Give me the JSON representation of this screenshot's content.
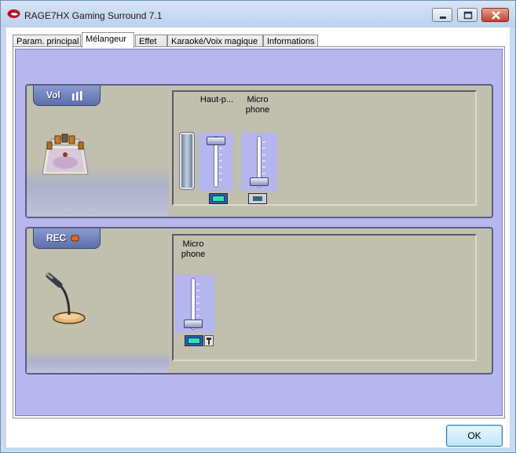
{
  "window": {
    "title": "RAGE7HX Gaming Surround 7.1",
    "app_icon": "red-lips-icon",
    "controls": [
      "minimize",
      "maximize",
      "close"
    ]
  },
  "tabs": [
    {
      "label": "Param. principal",
      "active": false
    },
    {
      "label": "Mélangeur",
      "active": true
    },
    {
      "label": "Effet",
      "active": false
    },
    {
      "label": "Karaoké/Voix magique",
      "active": false
    },
    {
      "label": "Informations",
      "active": false
    }
  ],
  "playback": {
    "header_label": "Vol",
    "header_icon": "speaker-bars-icon",
    "illustration": "speaker-room-icon",
    "channels": [
      {
        "label_line1": "Haut-p...",
        "label_line2": "",
        "enabled": true
      },
      {
        "label_line1": "Micro",
        "label_line2": "phone",
        "enabled": false
      }
    ]
  },
  "recording": {
    "header_label": "REC",
    "header_icon": "record-dot-icon",
    "illustration": "microphone-stand-icon",
    "channels": [
      {
        "label_line1": "Micro",
        "label_line2": "phone",
        "enabled": true,
        "settings_icon": "hammer-icon"
      }
    ]
  },
  "buttons": {
    "ok_label": "OK"
  },
  "colors": {
    "panel_bg": "#c1bfae",
    "lavender": "#b7b7ee",
    "toggle_on": "#34e0b0"
  }
}
